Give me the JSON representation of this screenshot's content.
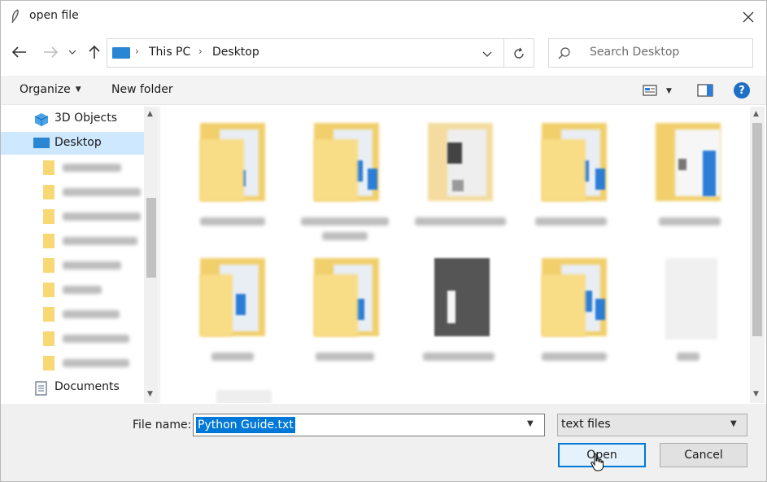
{
  "window": {
    "title": "open file"
  },
  "address_bar": {
    "crumbs": [
      "This PC",
      "Desktop"
    ],
    "search_placeholder": "Search Desktop"
  },
  "toolbar": {
    "organize_label": "Organize",
    "new_folder_label": "New folder",
    "help_label": "?"
  },
  "nav_pane": {
    "items": [
      {
        "label": "3D Objects",
        "icon": "3d-objects-icon"
      },
      {
        "label": "Desktop",
        "icon": "desktop-icon",
        "selected": true
      },
      {
        "label": "Documents",
        "icon": "documents-icon"
      }
    ]
  },
  "bottom": {
    "file_name_label": "File name:",
    "file_name_value": "Python Guide.txt",
    "file_type_value": "text files",
    "open_label": "Open",
    "cancel_label": "Cancel"
  },
  "colors": {
    "accent": "#0078d7",
    "selection": "#cde8ff",
    "folder": "#f8d775"
  }
}
